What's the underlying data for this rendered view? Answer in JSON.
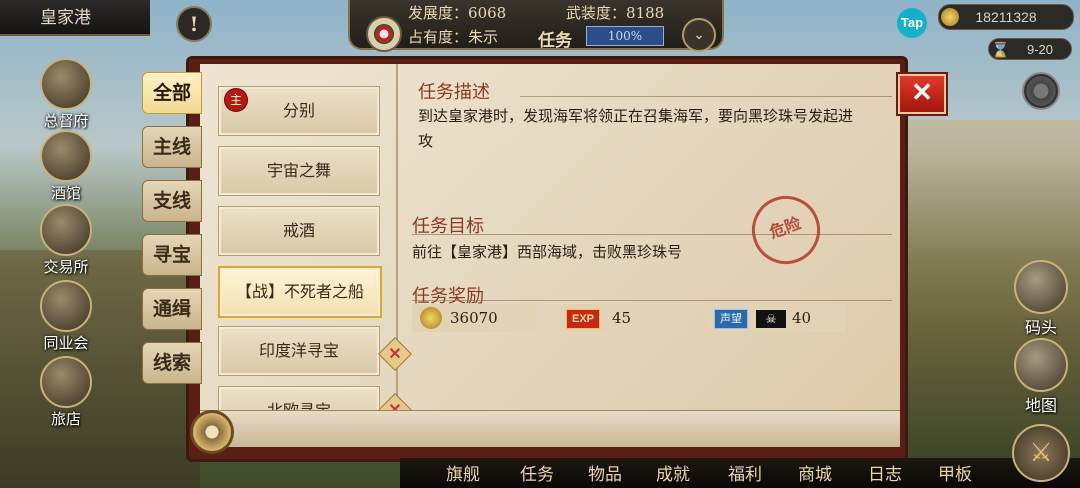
{
  "top": {
    "city": "皇家港",
    "alert": "!",
    "development_label": "发展度",
    "development_value": "6068",
    "armament_label": "武装度",
    "armament_value": "8188",
    "occupancy_label": "占有度",
    "occupancy_value": "朱示",
    "task_label": "任务",
    "task_progress": "100%",
    "tap": "Tap",
    "gold": "18211328",
    "time": "9-20"
  },
  "left_icons": [
    "总督府",
    "酒馆",
    "交易所",
    "同业会",
    "旅店"
  ],
  "right_icons": [
    "码头",
    "地图"
  ],
  "tabs": [
    "全部",
    "主线",
    "支线",
    "寻宝",
    "通缉",
    "线索"
  ],
  "quests": [
    {
      "name": "分别"
    },
    {
      "name": "宇宙之舞"
    },
    {
      "name": "戒酒"
    },
    {
      "name": "【战】不死者之船"
    },
    {
      "name": "印度洋寻宝"
    },
    {
      "name": "北欧寻宝"
    }
  ],
  "main_badge": "主",
  "detail": {
    "desc_title": "任务描述",
    "desc_text": "到达皇家港时，发现海军将领正在召集海军，要向黑珍珠号发起进攻",
    "goal_title": "任务目标",
    "goal_text": "前往【皇家港】西部海域，击败黑珍珠号",
    "reward_title": "任务奖励",
    "reward_gold": "36070",
    "reward_exp_tag": "EXP",
    "reward_exp": "45",
    "reward_rep_tag": "声望",
    "reward_rep": "40",
    "stamp": "危险"
  },
  "close": "✕",
  "bottom_nav": [
    "旗舰",
    "任务",
    "物品",
    "成就",
    "福利",
    "商城",
    "日志",
    "甲板"
  ]
}
